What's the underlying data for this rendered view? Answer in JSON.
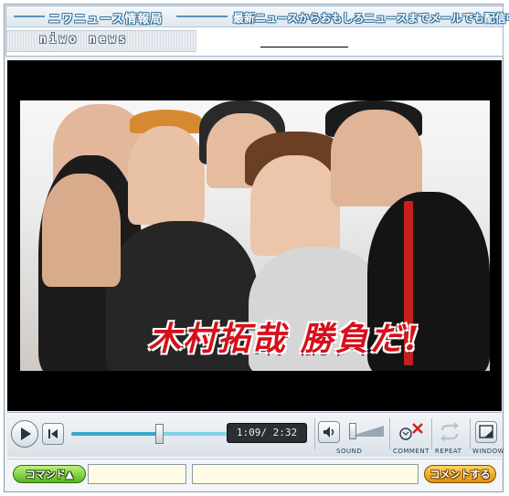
{
  "header": {
    "title": "ニワニュース情報局",
    "tagline": "最新ニュースからおもしろニュースまでメールでも配信中!",
    "logo_text": "niwo news"
  },
  "video": {
    "caption": "木村拓哉 勝負だ!"
  },
  "player": {
    "progress": 0.568,
    "time_display": "1:09/ 2:32",
    "volume_level": 0.0,
    "labels": {
      "sound": "SOUND",
      "comment": "COMMENT",
      "repeat": "REPEAT",
      "window": "WINDOW"
    },
    "icons": {
      "play": "play-icon",
      "prev": "skip-back-icon",
      "sound": "speaker-icon",
      "comment": "comment-off-icon",
      "repeat": "repeat-icon",
      "window": "window-icon"
    }
  },
  "comment_bar": {
    "command_label": "コマンド▲",
    "command_value": "",
    "comment_value": "",
    "submit_label": "コメントする"
  },
  "colors": {
    "accent_blue": "#3aa7c8",
    "command_green": "#58b51c",
    "submit_orange": "#e08e09",
    "caption_red": "#d6101a"
  }
}
